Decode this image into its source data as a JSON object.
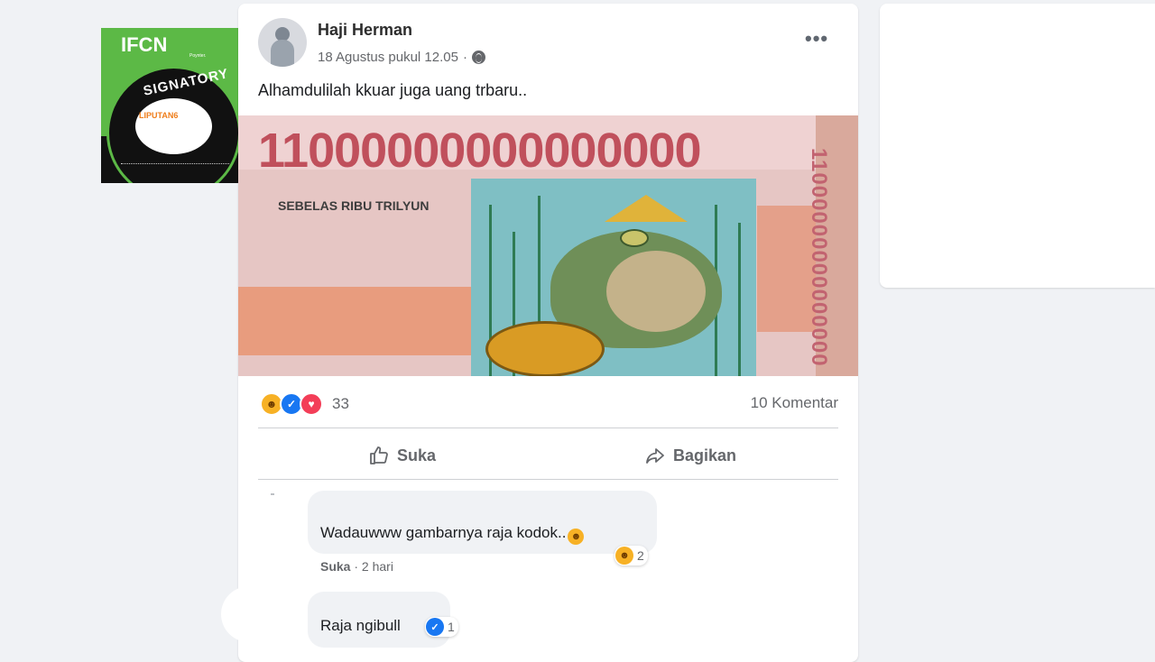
{
  "badge": {
    "brand": "IFCN",
    "brand_sub": "Poynter.",
    "ring_text": "SIGNATORY",
    "logo_text": "LIPUTAN6"
  },
  "post": {
    "author": "Haji Herman",
    "timestamp": "18 Agustus pukul 12.05",
    "separator": "·",
    "privacy_icon": "globe-icon",
    "more_label": "•••",
    "text": "Alhamdulilah kkuar juga uang trbaru..",
    "image": {
      "amount": "11000000000000000",
      "amount_words": "SEBELAS RIBU TRILYUN",
      "amount_vertical": "11000000000000000"
    },
    "reactions": {
      "icons": [
        "haha-icon",
        "like-icon",
        "love-icon"
      ],
      "count": "33"
    },
    "comments_count": "10 Komentar",
    "actions": {
      "like": "Suka",
      "share": "Bagikan"
    }
  },
  "comments": [
    {
      "text": "Wadauwww gambarnya raja kodok..",
      "reaction_icon": "haha-icon",
      "reaction_count": "2",
      "like_label": "Suka",
      "separator": "·",
      "time": "2 hari"
    },
    {
      "text": "Raja ngibull",
      "reaction_icon": "like-icon",
      "reaction_count": "1"
    }
  ],
  "colors": {
    "like_blue": "#1877f2",
    "love_red": "#f33e58",
    "haha_yellow": "#f7b125",
    "ifcn_green": "#5cb946"
  }
}
